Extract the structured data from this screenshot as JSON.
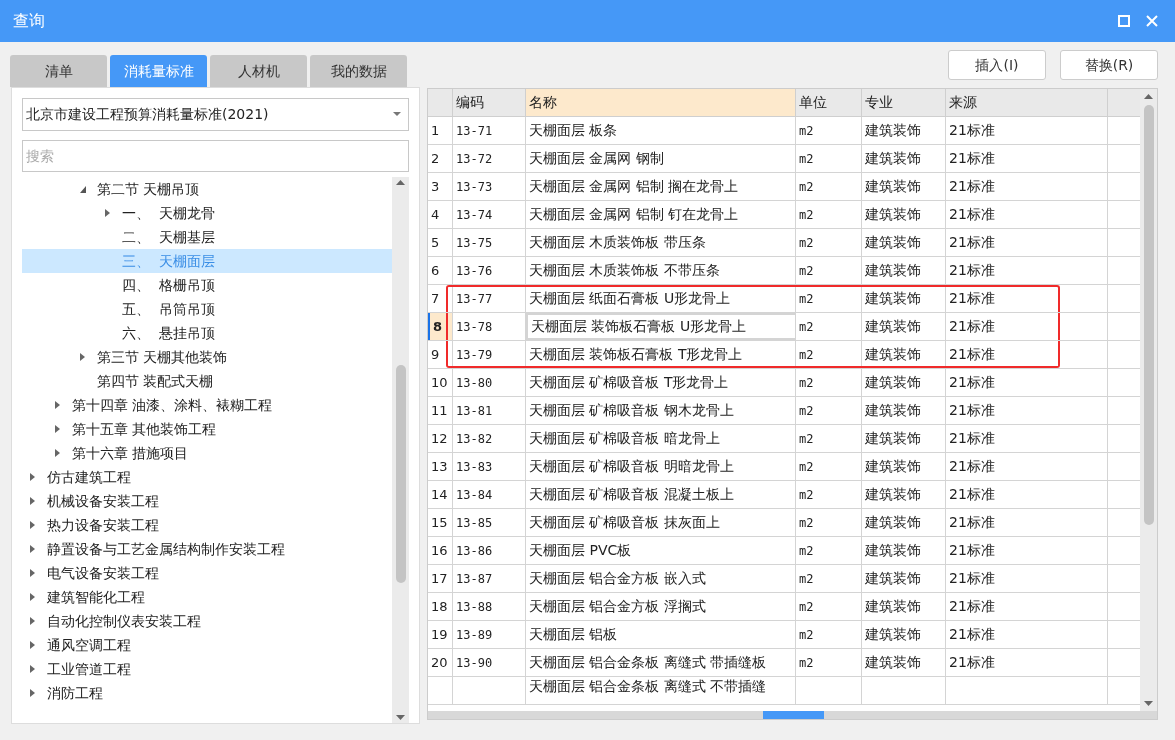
{
  "window": {
    "title": "查询"
  },
  "tabs": [
    {
      "label": "清单",
      "selected": false
    },
    {
      "label": "消耗量标准",
      "selected": true
    },
    {
      "label": "人材机",
      "selected": false
    },
    {
      "label": "我的数据",
      "selected": false
    }
  ],
  "standard_select": {
    "value": "北京市建设工程预算消耗量标准(2021)"
  },
  "search": {
    "placeholder": "搜索"
  },
  "tree": [
    {
      "children": [
        {
          "children": [
            {
              "label": "第二节 天棚吊顶",
              "expanded": true,
              "selected": false,
              "children": [
                {
                  "label": "一、  天棚龙骨",
                  "expanded": false,
                  "selected": false
                },
                {
                  "label": "二、  天棚基层",
                  "selected": false
                },
                {
                  "label": "三、  天棚面层",
                  "selected": true
                },
                {
                  "label": "四、  格栅吊顶",
                  "selected": false
                },
                {
                  "label": "五、  吊筒吊顶",
                  "selected": false
                },
                {
                  "label": "六、  悬挂吊顶",
                  "selected": false
                }
              ]
            },
            {
              "label": "第三节 天棚其他装饰",
              "expanded": false,
              "selected": false
            },
            {
              "label": "第四节 装配式天棚",
              "selected": false
            }
          ]
        },
        {
          "label": "第十四章 油漆、涂料、裱糊工程",
          "expanded": false,
          "selected": false
        },
        {
          "label": "第十五章 其他装饰工程",
          "expanded": false,
          "selected": false
        },
        {
          "label": "第十六章 措施项目",
          "expanded": false,
          "selected": false
        }
      ]
    },
    {
      "label": "仿古建筑工程",
      "expanded": false,
      "selected": false
    },
    {
      "label": "机械设备安装工程",
      "expanded": false,
      "selected": false
    },
    {
      "label": "热力设备安装工程",
      "expanded": false,
      "selected": false
    },
    {
      "label": "静置设备与工艺金属结构制作安装工程",
      "expanded": false,
      "selected": false
    },
    {
      "label": "电气设备安装工程",
      "expanded": false,
      "selected": false
    },
    {
      "label": "建筑智能化工程",
      "expanded": false,
      "selected": false
    },
    {
      "label": "自动化控制仪表安装工程",
      "expanded": false,
      "selected": false
    },
    {
      "label": "通风空调工程",
      "expanded": false,
      "selected": false
    },
    {
      "label": "工业管道工程",
      "expanded": false,
      "selected": false
    },
    {
      "label": "消防工程",
      "expanded": false,
      "selected": false
    }
  ],
  "buttons": [
    {
      "label": "插入(I)"
    },
    {
      "label": "替换(R)"
    }
  ],
  "table": {
    "columns": [
      {
        "label": "编码",
        "selected": false
      },
      {
        "label": "名称",
        "selected": true
      },
      {
        "label": "单位",
        "selected": false
      },
      {
        "label": "专业",
        "selected": false
      },
      {
        "label": "来源",
        "selected": false
      }
    ],
    "rows": [
      {
        "num": "1",
        "code": "13-71",
        "name": "天棚面层 板条",
        "unit": "m2",
        "major": "建筑装饰",
        "source": "21标准",
        "selected": false,
        "highlighted": false
      },
      {
        "num": "2",
        "code": "13-72",
        "name": "天棚面层 金属网 钢制",
        "unit": "m2",
        "major": "建筑装饰",
        "source": "21标准",
        "selected": false,
        "highlighted": false
      },
      {
        "num": "3",
        "code": "13-73",
        "name": "天棚面层 金属网 铝制 搁在龙骨上",
        "unit": "m2",
        "major": "建筑装饰",
        "source": "21标准",
        "selected": false,
        "highlighted": false
      },
      {
        "num": "4",
        "code": "13-74",
        "name": "天棚面层 金属网 铝制 钉在龙骨上",
        "unit": "m2",
        "major": "建筑装饰",
        "source": "21标准",
        "selected": false,
        "highlighted": false
      },
      {
        "num": "5",
        "code": "13-75",
        "name": "天棚面层 木质装饰板 带压条",
        "unit": "m2",
        "major": "建筑装饰",
        "source": "21标准",
        "selected": false,
        "highlighted": false
      },
      {
        "num": "6",
        "code": "13-76",
        "name": "天棚面层 木质装饰板 不带压条",
        "unit": "m2",
        "major": "建筑装饰",
        "source": "21标准",
        "selected": false,
        "highlighted": false
      },
      {
        "num": "7",
        "code": "13-77",
        "name": "天棚面层 纸面石膏板 U形龙骨上",
        "unit": "m2",
        "major": "建筑装饰",
        "source": "21标准",
        "selected": false,
        "highlighted": true
      },
      {
        "num": "8",
        "code": "13-78",
        "name": "天棚面层 装饰板石膏板 U形龙骨上",
        "unit": "m2",
        "major": "建筑装饰",
        "source": "21标准",
        "selected": true,
        "highlighted": true
      },
      {
        "num": "9",
        "code": "13-79",
        "name": "天棚面层 装饰板石膏板 T形龙骨上",
        "unit": "m2",
        "major": "建筑装饰",
        "source": "21标准",
        "selected": false,
        "highlighted": true
      },
      {
        "num": "10",
        "code": "13-80",
        "name": "天棚面层 矿棉吸音板 T形龙骨上",
        "unit": "m2",
        "major": "建筑装饰",
        "source": "21标准",
        "selected": false,
        "highlighted": false
      },
      {
        "num": "11",
        "code": "13-81",
        "name": "天棚面层 矿棉吸音板 钢木龙骨上",
        "unit": "m2",
        "major": "建筑装饰",
        "source": "21标准",
        "selected": false,
        "highlighted": false
      },
      {
        "num": "12",
        "code": "13-82",
        "name": "天棚面层 矿棉吸音板 暗龙骨上",
        "unit": "m2",
        "major": "建筑装饰",
        "source": "21标准",
        "selected": false,
        "highlighted": false
      },
      {
        "num": "13",
        "code": "13-83",
        "name": "天棚面层 矿棉吸音板 明暗龙骨上",
        "unit": "m2",
        "major": "建筑装饰",
        "source": "21标准",
        "selected": false,
        "highlighted": false
      },
      {
        "num": "14",
        "code": "13-84",
        "name": "天棚面层 矿棉吸音板 混凝土板上",
        "unit": "m2",
        "major": "建筑装饰",
        "source": "21标准",
        "selected": false,
        "highlighted": false
      },
      {
        "num": "15",
        "code": "13-85",
        "name": "天棚面层 矿棉吸音板 抹灰面上",
        "unit": "m2",
        "major": "建筑装饰",
        "source": "21标准",
        "selected": false,
        "highlighted": false
      },
      {
        "num": "16",
        "code": "13-86",
        "name": "天棚面层 PVC板",
        "unit": "m2",
        "major": "建筑装饰",
        "source": "21标准",
        "selected": false,
        "highlighted": false
      },
      {
        "num": "17",
        "code": "13-87",
        "name": "天棚面层 铝合金方板 嵌入式",
        "unit": "m2",
        "major": "建筑装饰",
        "source": "21标准",
        "selected": false,
        "highlighted": false
      },
      {
        "num": "18",
        "code": "13-88",
        "name": "天棚面层 铝合金方板 浮搁式",
        "unit": "m2",
        "major": "建筑装饰",
        "source": "21标准",
        "selected": false,
        "highlighted": false
      },
      {
        "num": "19",
        "code": "13-89",
        "name": "天棚面层 铝板",
        "unit": "m2",
        "major": "建筑装饰",
        "source": "21标准",
        "selected": false,
        "highlighted": false
      },
      {
        "num": "20",
        "code": "13-90",
        "name": "天棚面层 铝合金条板 离缝式 带插缝板",
        "unit": "m2",
        "major": "建筑装饰",
        "source": "21标准",
        "selected": false,
        "highlighted": false
      },
      {
        "name": "天棚面层 铝合金条板 离缝式 不带插缝",
        "selected": false,
        "highlighted": false
      }
    ]
  }
}
